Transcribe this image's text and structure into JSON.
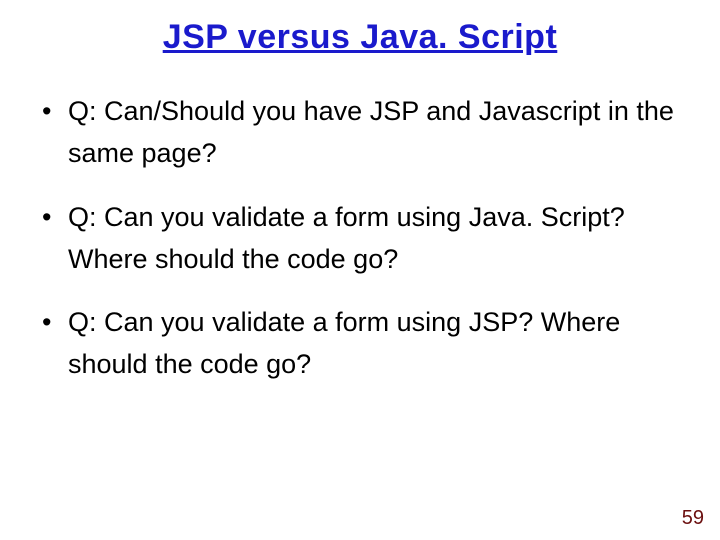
{
  "slide": {
    "title": "JSP versus Java. Script",
    "bullets": [
      "Q: Can/Should you have JSP and Javascript in the same page?",
      "Q: Can you validate a form using Java. Script? Where should the code go?",
      "Q: Can you validate a form using JSP? Where should the code go?"
    ],
    "page_number": "59"
  }
}
